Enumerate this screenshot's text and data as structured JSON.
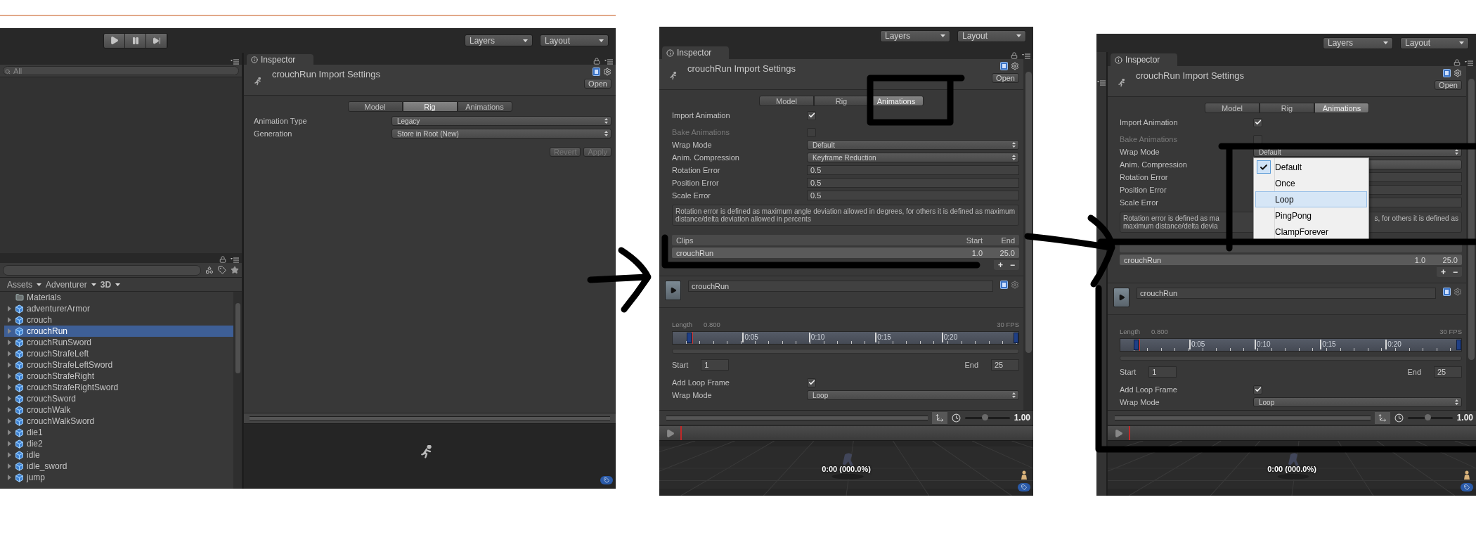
{
  "left_window": {
    "layers": "Layers",
    "layout": "Layout",
    "hierarchy": {
      "search_placeholder": "All"
    },
    "project": {
      "breadcrumb": [
        "Assets",
        "Adventurer",
        "3D"
      ],
      "items": [
        {
          "label": "Materials",
          "kind": "folder",
          "selected": false
        },
        {
          "label": "adventurerArmor",
          "kind": "model",
          "selected": false,
          "expanded": false
        },
        {
          "label": "crouch",
          "kind": "model",
          "selected": false,
          "expanded": false
        },
        {
          "label": "crouchRun",
          "kind": "model",
          "selected": true,
          "expanded": false
        },
        {
          "label": "crouchRunSword",
          "kind": "model",
          "selected": false,
          "expanded": false
        },
        {
          "label": "crouchStrafeLeft",
          "kind": "model",
          "selected": false,
          "expanded": false
        },
        {
          "label": "crouchStrafeLeftSword",
          "kind": "model",
          "selected": false,
          "expanded": false
        },
        {
          "label": "crouchStrafeRight",
          "kind": "model",
          "selected": false,
          "expanded": false
        },
        {
          "label": "crouchStrafeRightSword",
          "kind": "model",
          "selected": false,
          "expanded": false
        },
        {
          "label": "crouchSword",
          "kind": "model",
          "selected": false,
          "expanded": false
        },
        {
          "label": "crouchWalk",
          "kind": "model",
          "selected": false,
          "expanded": false
        },
        {
          "label": "crouchWalkSword",
          "kind": "model",
          "selected": false,
          "expanded": false
        },
        {
          "label": "die1",
          "kind": "model",
          "selected": false,
          "expanded": false
        },
        {
          "label": "die2",
          "kind": "model",
          "selected": false,
          "expanded": false
        },
        {
          "label": "idle",
          "kind": "model",
          "selected": false,
          "expanded": false
        },
        {
          "label": "idle_sword",
          "kind": "model",
          "selected": false,
          "expanded": false
        },
        {
          "label": "jump",
          "kind": "model",
          "selected": false,
          "expanded": false
        }
      ]
    },
    "inspector": {
      "tab": "Inspector",
      "title": "crouchRun Import Settings",
      "open_button": "Open",
      "tabs": [
        {
          "label": "Model",
          "selected": false
        },
        {
          "label": "Rig",
          "selected": true
        },
        {
          "label": "Animations",
          "selected": false
        }
      ],
      "rows": [
        {
          "kind": "dropdown",
          "label": "Animation Type",
          "value": "Legacy"
        },
        {
          "kind": "dropdown",
          "label": "Generation",
          "value": "Store in Root (New)"
        }
      ],
      "buttons": [
        {
          "label": "Revert",
          "disabled": true
        },
        {
          "label": "Apply",
          "disabled": true
        }
      ]
    }
  },
  "middle_window": {
    "layers": "Layers",
    "layout": "Layout",
    "inspector": {
      "tab": "Inspector",
      "title": "crouchRun Import Settings",
      "open_button": "Open",
      "tabs": [
        {
          "label": "Model",
          "selected": false
        },
        {
          "label": "Rig",
          "selected": false
        },
        {
          "label": "Animations",
          "selected": true
        }
      ],
      "rows": [
        {
          "kind": "checkbox",
          "label": "Import Animation",
          "checked": true,
          "disabled": false
        },
        {
          "kind": "checkbox",
          "label": "Bake Animations",
          "checked": false,
          "disabled": true
        },
        {
          "kind": "dropdown",
          "label": "Wrap Mode",
          "value": "Default"
        },
        {
          "kind": "dropdown",
          "label": "Anim. Compression",
          "value": "Keyframe Reduction"
        },
        {
          "kind": "field",
          "label": "Rotation Error",
          "value": "0.5"
        },
        {
          "kind": "field",
          "label": "Position Error",
          "value": "0.5"
        },
        {
          "kind": "field",
          "label": "Scale Error",
          "value": "0.5"
        }
      ],
      "help": {
        "kind": "full",
        "text": "Rotation error is defined as maximum angle deviation allowed in degrees, for others it is defined as maximum distance/delta deviation allowed in percents"
      },
      "clips": {
        "columns": [
          "Clips",
          "Start",
          "End"
        ],
        "rows": [
          {
            "name": "crouchRun",
            "start": "1.0",
            "end": "25.0"
          }
        ],
        "add": "+",
        "remove": "−"
      },
      "clip": {
        "name": "crouchRun",
        "length_label": "Length",
        "length": "0.800",
        "fps": "30 FPS",
        "ruler": [
          "0:05",
          "0:10",
          "0:15",
          "0:20"
        ],
        "start_label": "Start",
        "start": "1",
        "end_label": "End",
        "end": "25",
        "rows": [
          {
            "kind": "checkbox",
            "label": "Add Loop Frame",
            "checked": true,
            "disabled": false
          },
          {
            "kind": "dropdown",
            "label": "Wrap Mode",
            "value": "Loop"
          }
        ]
      }
    },
    "preview": {
      "speed": "1.00",
      "speed_slider": {
        "level": 0.45
      },
      "time": "0:00 (000.0%)"
    }
  },
  "right_window": {
    "layers": "Layers",
    "layout": "Layout",
    "inspector": {
      "tab": "Inspector",
      "title": "crouchRun Import Settings",
      "open_button": "Open",
      "tabs": [
        {
          "label": "Model",
          "selected": false
        },
        {
          "label": "Rig",
          "selected": false
        },
        {
          "label": "Animations",
          "selected": true
        }
      ],
      "rows": [
        {
          "kind": "checkbox",
          "label": "Import Animation",
          "checked": true,
          "disabled": false
        },
        {
          "kind": "checkbox",
          "label": "Bake Animations",
          "checked": false,
          "disabled": true
        },
        {
          "kind": "dropdown",
          "label": "Wrap Mode",
          "value": "Default",
          "menu": {
            "items": [
              {
                "label": "Default",
                "checked": true,
                "selected": false
              },
              {
                "label": "Once",
                "checked": false,
                "selected": false
              },
              {
                "label": "Loop",
                "checked": false,
                "selected": true
              },
              {
                "label": "PingPong",
                "checked": false,
                "selected": false
              },
              {
                "label": "ClampForever",
                "checked": false,
                "selected": false
              }
            ]
          }
        },
        {
          "kind": "dropdown",
          "label": "Anim. Compression"
        },
        {
          "kind": "field",
          "label": "Rotation Error"
        },
        {
          "kind": "field",
          "label": "Position Error"
        },
        {
          "kind": "field",
          "label": "Scale Error"
        }
      ],
      "help": {
        "kind": "covered",
        "left_lines": [
          "Rotation error is defined as ma",
          "maximum distance/delta devia"
        ],
        "right_lines": [
          "s, for others it is defined as"
        ]
      },
      "clips": {
        "rows": [
          {
            "name": "crouchRun",
            "start": "1.0",
            "end": "25.0"
          }
        ],
        "add": "+",
        "remove": "−"
      },
      "clip": {
        "name": "crouchRun",
        "length_label": "Length",
        "length": "0.800",
        "fps": "30 FPS",
        "ruler": [
          "0:05",
          "0:10",
          "0:15",
          "0:20"
        ],
        "start_label": "Start",
        "start": "1",
        "end_label": "End",
        "end": "25",
        "rows": [
          {
            "kind": "checkbox",
            "label": "Add Loop Frame",
            "checked": true,
            "disabled": false
          },
          {
            "kind": "dropdown",
            "label": "Wrap Mode",
            "value": "Loop"
          }
        ]
      }
    },
    "preview": {
      "speed": "1.00",
      "speed_slider": {
        "level": 0.45
      },
      "time": "0:00 (000.0%)"
    }
  }
}
